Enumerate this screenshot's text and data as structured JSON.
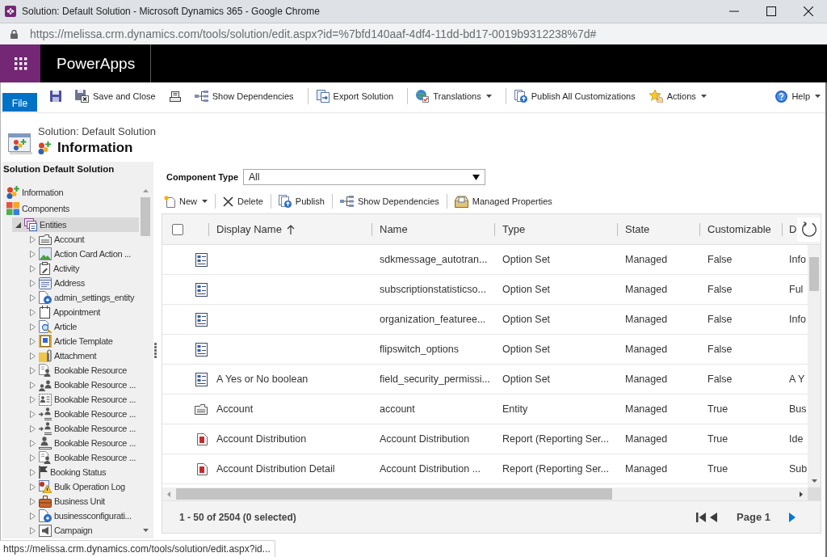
{
  "browser": {
    "title": "Solution: Default Solution - Microsoft Dynamics 365 - Google Chrome",
    "url": "https://melissa.crm.dynamics.com/tools/solution/edit.aspx?id=%7bfd140aaf-4df4-11dd-bd17-0019b9312238%7d#"
  },
  "app_bar": {
    "title": "PowerApps"
  },
  "ribbon": {
    "file_button": "File",
    "groups": [
      [
        {
          "kind": "save",
          "dropdown": false
        },
        {
          "kind": "save_close",
          "label": "Save and Close",
          "dropdown": false
        },
        {
          "kind": "print",
          "dropdown": false
        },
        {
          "kind": "dependencies",
          "label": "Show Dependencies",
          "dropdown": false
        }
      ],
      [
        {
          "kind": "export",
          "label": "Export Solution",
          "dropdown": false
        }
      ],
      [
        {
          "kind": "translations",
          "label": "Translations",
          "dropdown": true
        }
      ],
      [
        {
          "kind": "publish",
          "label": "Publish All Customizations",
          "dropdown": false
        },
        {
          "kind": "actions",
          "label": "Actions",
          "dropdown": true
        }
      ]
    ],
    "help": {
      "label": "Help",
      "dropdown": true
    }
  },
  "page_header": {
    "subtitle": "Solution: Default Solution",
    "title": "Information"
  },
  "navigation": {
    "title": "Solution Default Solution",
    "tree": [
      {
        "label": "Information",
        "kind": "solution",
        "selected": false
      },
      {
        "label": "Components",
        "kind": "components",
        "selected": false,
        "children": [
          {
            "label": "Entities",
            "kind": "entities",
            "selected": true,
            "expanded": true,
            "children": [
              {
                "label": "Account",
                "kind": "card",
                "selected": false,
                "expanded": false
              },
              {
                "label": "Action Card Action ...",
                "kind": "image",
                "selected": false,
                "expanded": false
              },
              {
                "label": "Activity",
                "kind": "clipboard",
                "selected": false,
                "expanded": false
              },
              {
                "label": "Address",
                "kind": "address",
                "selected": false,
                "expanded": false
              },
              {
                "label": "admin_settings_entity",
                "kind": "gear_doc",
                "selected": false,
                "expanded": false
              },
              {
                "label": "Appointment",
                "kind": "calendar",
                "selected": false,
                "expanded": false
              },
              {
                "label": "Article",
                "kind": "search_doc",
                "selected": false,
                "expanded": false
              },
              {
                "label": "Article Template",
                "kind": "template",
                "selected": false,
                "expanded": false
              },
              {
                "label": "Attachment",
                "kind": "attachment",
                "selected": false,
                "expanded": false
              },
              {
                "label": "Bookable Resource",
                "kind": "person_doc",
                "selected": false,
                "expanded": false
              },
              {
                "label": "Bookable Resource ...",
                "kind": "people",
                "selected": false,
                "expanded": false
              },
              {
                "label": "Bookable Resource ...",
                "kind": "people_list",
                "selected": false,
                "expanded": false
              },
              {
                "label": "Bookable Resource ...",
                "kind": "arrow_person",
                "selected": false,
                "expanded": false
              },
              {
                "label": "Bookable Resource ...",
                "kind": "arrow_person",
                "selected": false,
                "expanded": false
              },
              {
                "label": "Bookable Resource ...",
                "kind": "person_line",
                "selected": false,
                "expanded": false
              },
              {
                "label": "Bookable Resource ...",
                "kind": "person_doc",
                "selected": false,
                "expanded": false
              },
              {
                "label": "Booking Status",
                "kind": "flag",
                "selected": false,
                "expanded": false
              },
              {
                "label": "Bulk Operation Log",
                "kind": "warning_doc",
                "selected": false,
                "expanded": false
              },
              {
                "label": "Business Unit",
                "kind": "briefcase",
                "selected": false,
                "expanded": false
              },
              {
                "label": "businessconfigurati...",
                "kind": "gear_doc",
                "selected": false,
                "expanded": false
              },
              {
                "label": "Campaign",
                "kind": "campaign",
                "selected": false,
                "expanded": false
              }
            ]
          }
        ]
      }
    ]
  },
  "component_type": {
    "label": "Component Type",
    "value": "All"
  },
  "toolbar": [
    {
      "kind": "new",
      "label": "New",
      "dropdown": true
    },
    {
      "kind": "delete",
      "label": "Delete",
      "dropdown": false
    },
    {
      "kind": "publish",
      "label": "Publish",
      "dropdown": false
    },
    {
      "kind": "dependencies",
      "label": "Show Dependencies",
      "dropdown": false
    },
    {
      "kind": "managed",
      "label": "Managed Properties",
      "dropdown": false
    }
  ],
  "grid": {
    "select_all": {
      "checked": false
    },
    "columns": [
      {
        "label": "Display Name",
        "sorted": true
      },
      {
        "label": "Name",
        "sorted": false
      },
      {
        "label": "Type",
        "sorted": false
      },
      {
        "label": "State",
        "sorted": false
      },
      {
        "label": "Customizable",
        "sorted": false
      },
      {
        "label": "D",
        "sorted": false
      }
    ],
    "rows": [
      {
        "kind": "option_set",
        "selected": false,
        "name": "sdkmessage_autotran...",
        "type": "Option Set",
        "state": "Managed",
        "customizable": "False",
        "column_6": "Info"
      },
      {
        "kind": "option_set",
        "selected": false,
        "name": "subscriptionstatisticso...",
        "type": "Option Set",
        "state": "Managed",
        "customizable": "False",
        "column_6": "Ful"
      },
      {
        "kind": "option_set",
        "selected": false,
        "name": "organization_featuree...",
        "type": "Option Set",
        "state": "Managed",
        "customizable": "False",
        "column_6": "Info"
      },
      {
        "kind": "option_set",
        "selected": false,
        "name": "flipswitch_options",
        "type": "Option Set",
        "state": "Managed",
        "customizable": "False"
      },
      {
        "kind": "option_set",
        "selected": false,
        "display_name": "A Yes or No boolean",
        "name": "field_security_permissi...",
        "type": "Option Set",
        "state": "Managed",
        "customizable": "False",
        "column_6": "A Y"
      },
      {
        "kind": "entity",
        "selected": false,
        "display_name": "Account",
        "name": "account",
        "type": "Entity",
        "state": "Managed",
        "customizable": "True",
        "column_6": "Bus"
      },
      {
        "kind": "report",
        "selected": false,
        "display_name": "Account Distribution",
        "name": "Account Distribution",
        "type": "Report (Reporting Ser...",
        "state": "Managed",
        "customizable": "True",
        "column_6": "Ide"
      },
      {
        "kind": "report",
        "selected": false,
        "display_name": "Account Distribution Detail",
        "name": "Account Distribution ...",
        "type": "Report (Reporting Ser...",
        "state": "Managed",
        "customizable": "True",
        "column_6": "Sub"
      }
    ]
  },
  "footer": {
    "summary": "1 - 50 of 2504 (0 selected)",
    "pager": {
      "first": {
        "disabled": true
      },
      "previous": {
        "disabled": true
      },
      "page": "Page 1",
      "next": {
        "disabled": false
      }
    }
  },
  "status_bubble": "https://melissa.crm.dynamics.com/tools/solution/edit.aspx?id..."
}
